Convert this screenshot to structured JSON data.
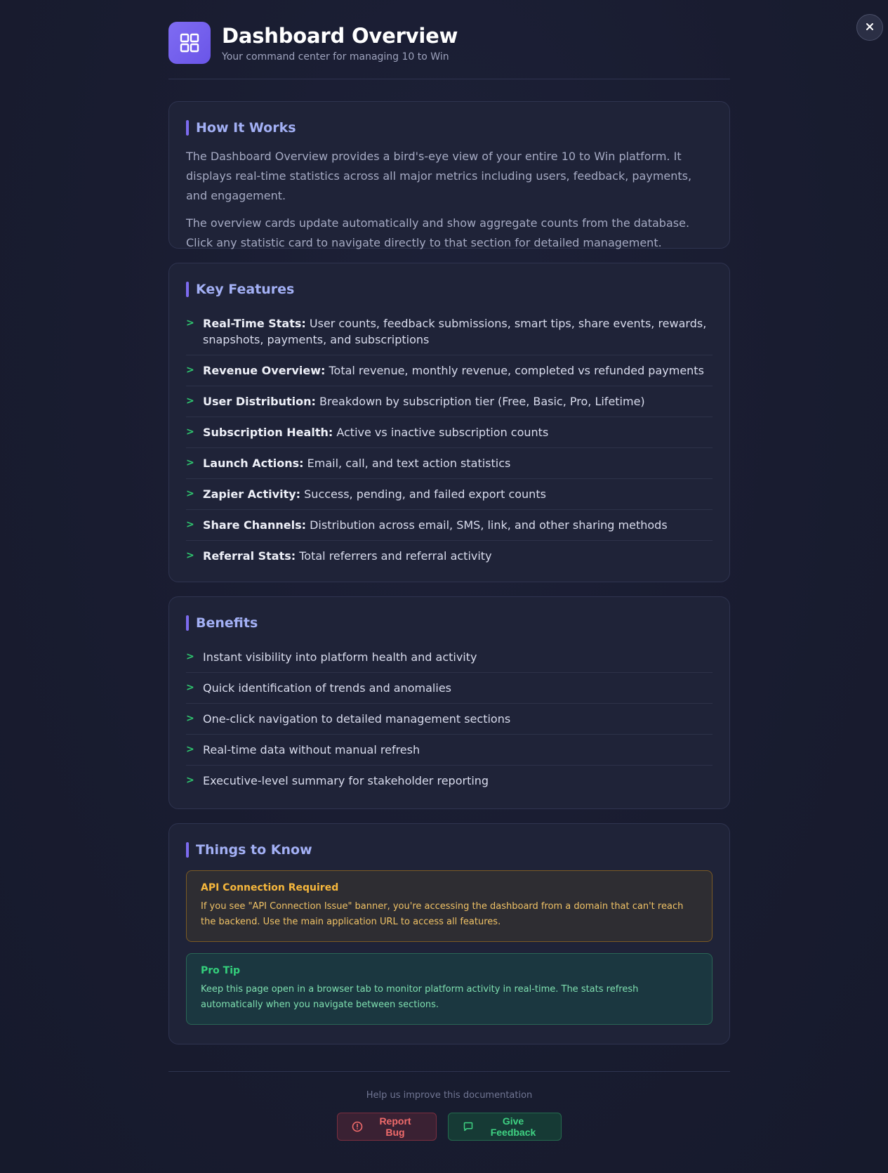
{
  "header": {
    "title": "Dashboard Overview",
    "subtitle": "Your command center for managing 10 to Win",
    "logo_icon": "grid-icon",
    "close_icon": "close-icon"
  },
  "how_it_works": {
    "title": "How It Works",
    "paragraphs": [
      "The Dashboard Overview provides a bird's-eye view of your entire 10 to Win platform. It displays real-time statistics across all major metrics including users, feedback, payments, and engagement.",
      "The overview cards update automatically and show aggregate counts from the database. Click any statistic card to navigate directly to that section for detailed management."
    ]
  },
  "key_features": {
    "title": "Key Features",
    "items": [
      {
        "label": "Real-Time Stats:",
        "text": "User counts, feedback submissions, smart tips, share events, rewards, snapshots, payments, and subscriptions"
      },
      {
        "label": "Revenue Overview:",
        "text": "Total revenue, monthly revenue, completed vs refunded payments"
      },
      {
        "label": "User Distribution:",
        "text": "Breakdown by subscription tier (Free, Basic, Pro, Lifetime)"
      },
      {
        "label": "Subscription Health:",
        "text": "Active vs inactive subscription counts"
      },
      {
        "label": "Launch Actions:",
        "text": "Email, call, and text action statistics"
      },
      {
        "label": "Zapier Activity:",
        "text": "Success, pending, and failed export counts"
      },
      {
        "label": "Share Channels:",
        "text": "Distribution across email, SMS, link, and other sharing methods"
      },
      {
        "label": "Referral Stats:",
        "text": "Total referrers and referral activity"
      }
    ]
  },
  "benefits": {
    "title": "Benefits",
    "items": [
      "Instant visibility into platform health and activity",
      "Quick identification of trends and anomalies",
      "One-click navigation to detailed management sections",
      "Real-time data without manual refresh",
      "Executive-level summary for stakeholder reporting"
    ]
  },
  "things_to_know": {
    "title": "Things to Know",
    "warning": {
      "title": "API Connection Required",
      "text": "If you see \"API Connection Issue\" banner, you're accessing the dashboard from a domain that can't reach the backend. Use the main application URL to access all features."
    },
    "tip": {
      "title": "Pro Tip",
      "text": "Keep this page open in a browser tab to monitor platform activity in real-time. The stats refresh automatically when you navigate between sections."
    }
  },
  "footer": {
    "note": "Help us improve this documentation",
    "report_bug_label": "Report Bug",
    "report_bug_icon": "alert-circle-icon",
    "feedback_label": "Give Feedback",
    "feedback_icon": "message-square-icon"
  },
  "colors": {
    "accent": "#7d6bf0",
    "check": "#2fc76f",
    "warning": "#f6b73c",
    "success": "#34d07c",
    "danger": "#f06b6b"
  }
}
